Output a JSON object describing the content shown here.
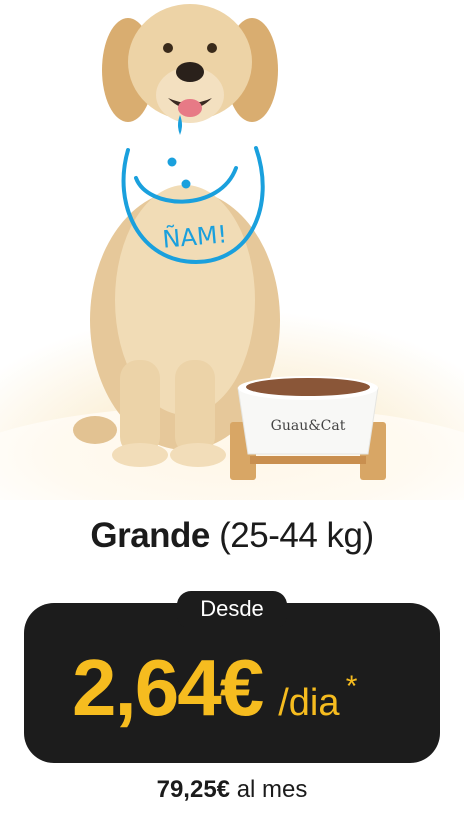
{
  "product": {
    "size_name": "Grande",
    "size_range": "(25-44 kg)",
    "bib_text": "ÑAM!",
    "bowl_brand": "Guau&Cat"
  },
  "pricing": {
    "prefix": "Desde",
    "daily_price": "2,64€",
    "daily_unit": "/dia",
    "asterisk": "*",
    "monthly_price": "79,25€",
    "monthly_label": "al mes"
  },
  "colors": {
    "accent_yellow": "#f6bc1f",
    "bib_blue": "#1aa0dd",
    "box_dark": "#1c1c1c"
  },
  "icons": [
    "dog-illustration",
    "bib-drawing",
    "food-bowl"
  ]
}
